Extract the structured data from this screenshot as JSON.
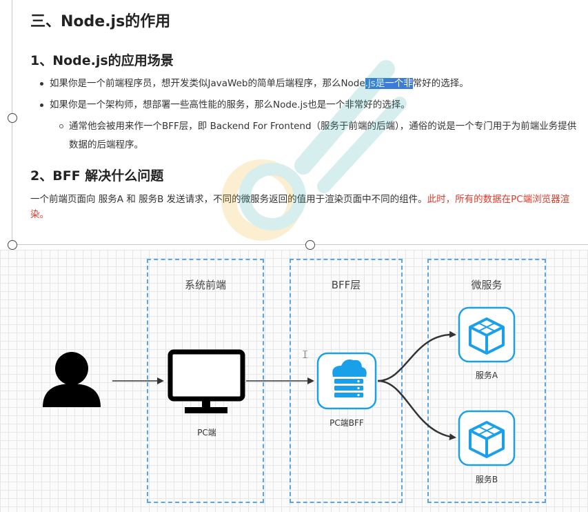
{
  "doc": {
    "section_title": "三、Node.js的作用",
    "sub1_title": "1、Node.js的应用场景",
    "bullets": [
      {
        "pre": "如果你是一个前端程序员，想开发类似JavaWeb的简单后端程序，那么Node",
        "highlight": ".js是一个非",
        "post": "常好的选择。"
      },
      {
        "text": "如果你是一个架构师，想部署一些高性能的服务，那么Node.js也是一个非常好的选择。"
      }
    ],
    "sub_bullet_line1": "通常他会被用来作一个BFF层，即 Backend For Frontend（服务于前端的后端），通俗的说是一个专门用于为前端业务提供",
    "sub_bullet_line2": "数据的后端程序。",
    "sub2_title": "2、BFF 解决什么问题",
    "para_normal": "一个前端页面向 服务A 和 服务B 发送请求，不同的微服务返回的值用于渲染页面中不同的组件。",
    "para_red": "此时，所有的数据在PC端浏览器渲",
    "para_line2": "染。"
  },
  "diagram": {
    "boxes": [
      "系统前端",
      "BFF层",
      "微服务"
    ],
    "pc_label": "PC端",
    "bff_label": "PC端BFF",
    "service_a": "服务A",
    "service_b": "服务B"
  },
  "colors": {
    "dash": "#5aa5e6",
    "service": "#1aa0e8",
    "red_text": "#e03a2a",
    "highlight": "#3d7bd9"
  }
}
